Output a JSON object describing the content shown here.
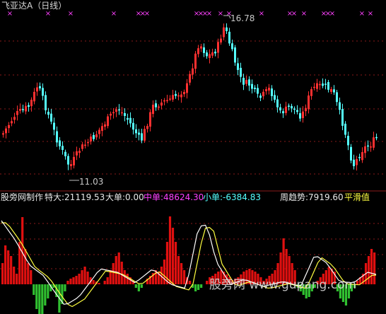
{
  "upper_panel": {
    "title": "飞亚达A（日线）",
    "high_label": "16.78",
    "low_label": "11.03",
    "colors": {
      "up": "#ff3030",
      "down": "#54ffff",
      "marker": "#ff40ff",
      "grid": "#8a1a1a",
      "label": "#c0c0c0"
    }
  },
  "lower_panel": {
    "indicator_name": "股旁网制作",
    "items": [
      {
        "label": "特大:21119.53",
        "color": "#e8e8e8"
      },
      {
        "label": "大单:0.00",
        "color": "#e8e8e8"
      },
      {
        "label": "中单:48624.30",
        "color": "#ff40ff"
      },
      {
        "label": "小单:-6384.83",
        "color": "#54ffff"
      },
      {
        "label": "周趋势:7919.60",
        "color": "#e8e8e8"
      },
      {
        "label": "平滑值",
        "color": "#ffff40"
      }
    ],
    "colors": {
      "pos_bar": "#e01010",
      "neg_bar": "#30c030",
      "line_white": "#ffffff",
      "line_yellow": "#ffff40"
    }
  },
  "watermark": "股旁网 www.gupang.com"
}
